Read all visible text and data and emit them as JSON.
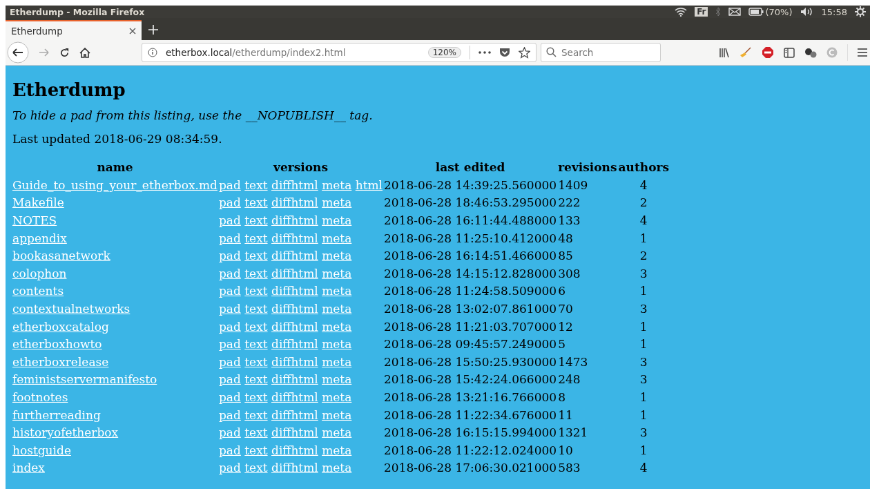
{
  "window": {
    "title": "Etherdump - Mozilla Firefox"
  },
  "system_tray": {
    "keyboard": "Fr",
    "battery": "(70%)",
    "clock": "15:58"
  },
  "tabs": [
    {
      "label": "Etherdump",
      "selected": true
    }
  ],
  "address_bar": {
    "host": "etherbox.local",
    "path": "/etherdump/index2.html",
    "zoom": "120%"
  },
  "search": {
    "placeholder": "Search"
  },
  "page": {
    "heading": "Etherdump",
    "note": "To hide a pad from this listing, use the __NOPUBLISH__ tag.",
    "updated": "Last updated 2018-06-29 08:34:59.",
    "table": {
      "columns": [
        "name",
        "versions",
        "last edited",
        "revisions",
        "authors"
      ],
      "rows": [
        {
          "name": "Guide_to_using_your_etherbox.md",
          "versions": [
            "pad",
            "text",
            "diffhtml",
            "meta",
            "html"
          ],
          "last_edited": "2018-06-28 14:39:25.560000",
          "revisions": "1409",
          "authors": "4"
        },
        {
          "name": "Makefile",
          "versions": [
            "pad",
            "text",
            "diffhtml",
            "meta"
          ],
          "last_edited": "2018-06-28 18:46:53.295000",
          "revisions": "222",
          "authors": "2"
        },
        {
          "name": "NOTES",
          "versions": [
            "pad",
            "text",
            "diffhtml",
            "meta"
          ],
          "last_edited": "2018-06-28 16:11:44.488000",
          "revisions": "133",
          "authors": "4"
        },
        {
          "name": "appendix",
          "versions": [
            "pad",
            "text",
            "diffhtml",
            "meta"
          ],
          "last_edited": "2018-06-28 11:25:10.412000",
          "revisions": "48",
          "authors": "1"
        },
        {
          "name": "bookasanetwork",
          "versions": [
            "pad",
            "text",
            "diffhtml",
            "meta"
          ],
          "last_edited": "2018-06-28 16:14:51.466000",
          "revisions": "85",
          "authors": "2"
        },
        {
          "name": "colophon",
          "versions": [
            "pad",
            "text",
            "diffhtml",
            "meta"
          ],
          "last_edited": "2018-06-28 14:15:12.828000",
          "revisions": "308",
          "authors": "3"
        },
        {
          "name": "contents",
          "versions": [
            "pad",
            "text",
            "diffhtml",
            "meta"
          ],
          "last_edited": "2018-06-28 11:24:58.509000",
          "revisions": "6",
          "authors": "1"
        },
        {
          "name": "contextualnetworks",
          "versions": [
            "pad",
            "text",
            "diffhtml",
            "meta"
          ],
          "last_edited": "2018-06-28 13:02:07.861000",
          "revisions": "70",
          "authors": "3"
        },
        {
          "name": "etherboxcatalog",
          "versions": [
            "pad",
            "text",
            "diffhtml",
            "meta"
          ],
          "last_edited": "2018-06-28 11:21:03.707000",
          "revisions": "12",
          "authors": "1"
        },
        {
          "name": "etherboxhowto",
          "versions": [
            "pad",
            "text",
            "diffhtml",
            "meta"
          ],
          "last_edited": "2018-06-28 09:45:57.249000",
          "revisions": "5",
          "authors": "1"
        },
        {
          "name": "etherboxrelease",
          "versions": [
            "pad",
            "text",
            "diffhtml",
            "meta"
          ],
          "last_edited": "2018-06-28 15:50:25.930000",
          "revisions": "1473",
          "authors": "3"
        },
        {
          "name": "feministservermanifesto",
          "versions": [
            "pad",
            "text",
            "diffhtml",
            "meta"
          ],
          "last_edited": "2018-06-28 15:42:24.066000",
          "revisions": "248",
          "authors": "3"
        },
        {
          "name": "footnotes",
          "versions": [
            "pad",
            "text",
            "diffhtml",
            "meta"
          ],
          "last_edited": "2018-06-28 13:21:16.766000",
          "revisions": "8",
          "authors": "1"
        },
        {
          "name": "furtherreading",
          "versions": [
            "pad",
            "text",
            "diffhtml",
            "meta"
          ],
          "last_edited": "2018-06-28 11:22:34.676000",
          "revisions": "11",
          "authors": "1"
        },
        {
          "name": "historyofetherbox",
          "versions": [
            "pad",
            "text",
            "diffhtml",
            "meta"
          ],
          "last_edited": "2018-06-28 16:15:15.994000",
          "revisions": "1321",
          "authors": "3"
        },
        {
          "name": "hostguide",
          "versions": [
            "pad",
            "text",
            "diffhtml",
            "meta"
          ],
          "last_edited": "2018-06-28 11:22:12.024000",
          "revisions": "10",
          "authors": "1"
        },
        {
          "name": "index",
          "versions": [
            "pad",
            "text",
            "diffhtml",
            "meta"
          ],
          "last_edited": "2018-06-28 17:06:30.021000",
          "revisions": "583",
          "authors": "4"
        }
      ]
    }
  }
}
